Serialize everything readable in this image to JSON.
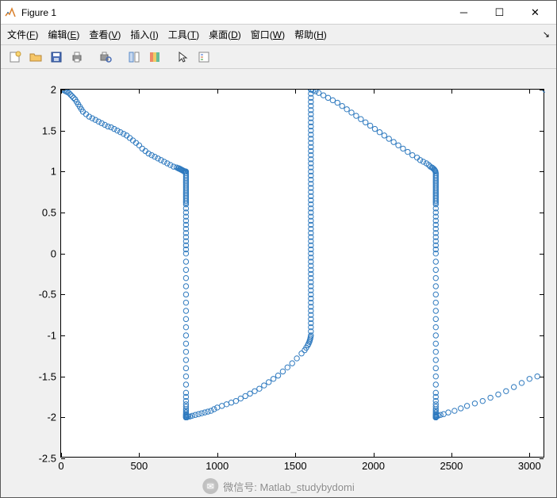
{
  "window": {
    "title": "Figure 1"
  },
  "menu": [
    "文件(F)",
    "编辑(E)",
    "查看(V)",
    "插入(I)",
    "工具(T)",
    "桌面(D)",
    "窗口(W)",
    "帮助(H)"
  ],
  "watermark": "微信号: Matlab_studybydomi",
  "chart_data": {
    "type": "scatter",
    "xlim": [
      0,
      3100
    ],
    "ylim": [
      -2.5,
      2
    ],
    "xticks": [
      0,
      500,
      1000,
      1500,
      2000,
      2500,
      3000
    ],
    "yticks": [
      -2.5,
      -2,
      -1.5,
      -1,
      -0.5,
      0,
      0.5,
      1,
      1.5,
      2
    ],
    "marker_color": "#2f7abf",
    "series": [
      {
        "name": "curve",
        "x": [
          0,
          10,
          20,
          30,
          40,
          50,
          60,
          70,
          80,
          90,
          100,
          110,
          120,
          130,
          140,
          160,
          180,
          200,
          220,
          240,
          260,
          280,
          300,
          320,
          340,
          360,
          380,
          400,
          420,
          440,
          460,
          480,
          500,
          520,
          540,
          560,
          580,
          600,
          620,
          640,
          660,
          680,
          700,
          720,
          740,
          750,
          755,
          760,
          765,
          770,
          775,
          780,
          785,
          790,
          792,
          794,
          796,
          798,
          800,
          800,
          800,
          800,
          800,
          800,
          800,
          800,
          800,
          800,
          800,
          800,
          800,
          800,
          800,
          800,
          800,
          800,
          800,
          800,
          800,
          800,
          800,
          800,
          800,
          800,
          800,
          800,
          800,
          800,
          800,
          800,
          800,
          800,
          800,
          800,
          800,
          800,
          800,
          800,
          800,
          800,
          800,
          800,
          800,
          800,
          800,
          800,
          800,
          800,
          800,
          800,
          800,
          800,
          800,
          800,
          800,
          800,
          800,
          800,
          800,
          800,
          800,
          805,
          815,
          825,
          840,
          860,
          880,
          900,
          920,
          940,
          960,
          980,
          1000,
          1030,
          1060,
          1090,
          1120,
          1150,
          1180,
          1210,
          1240,
          1270,
          1300,
          1330,
          1360,
          1390,
          1420,
          1450,
          1480,
          1510,
          1540,
          1560,
          1570,
          1580,
          1585,
          1590,
          1593,
          1596,
          1598,
          1600,
          1600,
          1600,
          1600,
          1600,
          1600,
          1600,
          1600,
          1600,
          1600,
          1600,
          1600,
          1600,
          1600,
          1600,
          1600,
          1600,
          1600,
          1600,
          1600,
          1600,
          1600,
          1600,
          1600,
          1600,
          1600,
          1600,
          1600,
          1600,
          1600,
          1600,
          1600,
          1600,
          1600,
          1600,
          1600,
          1600,
          1600,
          1600,
          1600,
          1600,
          1600,
          1600,
          1600,
          1600,
          1600,
          1600,
          1600,
          1600,
          1600,
          1600,
          1600,
          1600,
          1600,
          1600,
          1600,
          1600,
          1600,
          1600,
          1600,
          1600,
          1605,
          1615,
          1630,
          1650,
          1680,
          1710,
          1740,
          1770,
          1800,
          1830,
          1860,
          1890,
          1920,
          1950,
          1980,
          2010,
          2040,
          2070,
          2100,
          2130,
          2160,
          2190,
          2220,
          2250,
          2280,
          2300,
          2320,
          2340,
          2355,
          2365,
          2375,
          2382,
          2388,
          2392,
          2395,
          2398,
          2400,
          2400,
          2400,
          2400,
          2400,
          2400,
          2400,
          2400,
          2400,
          2400,
          2400,
          2400,
          2400,
          2400,
          2400,
          2400,
          2400,
          2400,
          2400,
          2400,
          2400,
          2400,
          2400,
          2400,
          2400,
          2400,
          2400,
          2400,
          2400,
          2400,
          2400,
          2400,
          2400,
          2400,
          2400,
          2400,
          2400,
          2400,
          2400,
          2400,
          2400,
          2400,
          2400,
          2400,
          2400,
          2400,
          2400,
          2400,
          2400,
          2400,
          2400,
          2400,
          2400,
          2400,
          2400,
          2400,
          2400,
          2400,
          2400,
          2400,
          2400,
          2400,
          2400,
          2400,
          2405,
          2415,
          2430,
          2450,
          2480,
          2520,
          2560,
          2600,
          2650,
          2700,
          2750,
          2800,
          2850,
          2900,
          2950,
          3000,
          3050,
          3100
        ],
        "y": [
          2.0,
          2.0,
          1.99,
          1.98,
          1.97,
          1.96,
          1.94,
          1.92,
          1.9,
          1.88,
          1.85,
          1.82,
          1.79,
          1.76,
          1.73,
          1.7,
          1.67,
          1.65,
          1.63,
          1.61,
          1.59,
          1.57,
          1.55,
          1.54,
          1.52,
          1.5,
          1.48,
          1.46,
          1.44,
          1.41,
          1.38,
          1.35,
          1.32,
          1.28,
          1.25,
          1.22,
          1.2,
          1.18,
          1.16,
          1.14,
          1.12,
          1.1,
          1.08,
          1.06,
          1.05,
          1.04,
          1.04,
          1.03,
          1.03,
          1.02,
          1.02,
          1.01,
          1.01,
          1.0,
          1.0,
          1.0,
          1.0,
          1.0,
          1.0,
          0.98,
          0.96,
          0.94,
          0.92,
          0.9,
          0.88,
          0.86,
          0.84,
          0.82,
          0.8,
          0.78,
          0.76,
          0.74,
          0.72,
          0.7,
          0.68,
          0.66,
          0.64,
          0.62,
          0.6,
          0.55,
          0.5,
          0.45,
          0.4,
          0.35,
          0.3,
          0.25,
          0.2,
          0.15,
          0.1,
          0.05,
          0.0,
          -0.1,
          -0.2,
          -0.3,
          -0.4,
          -0.5,
          -0.6,
          -0.7,
          -0.8,
          -0.9,
          -1.0,
          -1.1,
          -1.2,
          -1.3,
          -1.4,
          -1.5,
          -1.6,
          -1.7,
          -1.75,
          -1.8,
          -1.84,
          -1.87,
          -1.9,
          -1.92,
          -1.94,
          -1.96,
          -1.97,
          -1.98,
          -1.99,
          -2.0,
          -2.0,
          -2.0,
          -1.99,
          -1.99,
          -1.98,
          -1.97,
          -1.96,
          -1.95,
          -1.94,
          -1.93,
          -1.92,
          -1.9,
          -1.88,
          -1.86,
          -1.84,
          -1.82,
          -1.8,
          -1.77,
          -1.74,
          -1.71,
          -1.68,
          -1.65,
          -1.61,
          -1.57,
          -1.53,
          -1.49,
          -1.44,
          -1.39,
          -1.34,
          -1.28,
          -1.22,
          -1.18,
          -1.15,
          -1.12,
          -1.1,
          -1.08,
          -1.06,
          -1.04,
          -1.02,
          -1.0,
          -0.95,
          -0.9,
          -0.85,
          -0.8,
          -0.75,
          -0.7,
          -0.65,
          -0.6,
          -0.55,
          -0.5,
          -0.45,
          -0.4,
          -0.35,
          -0.3,
          -0.25,
          -0.2,
          -0.15,
          -0.1,
          -0.05,
          0.0,
          0.05,
          0.1,
          0.15,
          0.2,
          0.25,
          0.3,
          0.35,
          0.4,
          0.45,
          0.5,
          0.55,
          0.6,
          0.65,
          0.7,
          0.75,
          0.8,
          0.85,
          0.9,
          0.95,
          1.0,
          1.05,
          1.1,
          1.15,
          1.2,
          1.25,
          1.3,
          1.35,
          1.4,
          1.45,
          1.5,
          1.55,
          1.6,
          1.65,
          1.7,
          1.75,
          1.8,
          1.85,
          1.9,
          1.95,
          2.0,
          2.0,
          1.99,
          1.98,
          1.96,
          1.93,
          1.9,
          1.87,
          1.84,
          1.8,
          1.76,
          1.72,
          1.68,
          1.64,
          1.6,
          1.56,
          1.52,
          1.48,
          1.44,
          1.4,
          1.36,
          1.32,
          1.28,
          1.24,
          1.2,
          1.17,
          1.14,
          1.12,
          1.1,
          1.08,
          1.06,
          1.05,
          1.04,
          1.03,
          1.02,
          1.01,
          1.0,
          0.98,
          0.96,
          0.94,
          0.92,
          0.9,
          0.88,
          0.86,
          0.84,
          0.82,
          0.8,
          0.78,
          0.76,
          0.74,
          0.72,
          0.7,
          0.68,
          0.66,
          0.64,
          0.62,
          0.6,
          0.55,
          0.5,
          0.45,
          0.4,
          0.35,
          0.3,
          0.25,
          0.2,
          0.15,
          0.1,
          0.05,
          0.0,
          -0.1,
          -0.2,
          -0.3,
          -0.4,
          -0.5,
          -0.6,
          -0.7,
          -0.8,
          -0.9,
          -1.0,
          -1.1,
          -1.2,
          -1.3,
          -1.4,
          -1.5,
          -1.6,
          -1.7,
          -1.75,
          -1.8,
          -1.84,
          -1.87,
          -1.9,
          -1.92,
          -1.94,
          -1.96,
          -1.97,
          -1.98,
          -1.99,
          -2.0,
          -2.0,
          -2.0,
          -1.99,
          -1.99,
          -1.98,
          -1.97,
          -1.96,
          -1.94,
          -1.92,
          -1.89,
          -1.86,
          -1.83,
          -1.8,
          -1.76,
          -1.72,
          -1.68,
          -1.63,
          -1.58,
          -1.53,
          -1.5
        ]
      }
    ]
  }
}
